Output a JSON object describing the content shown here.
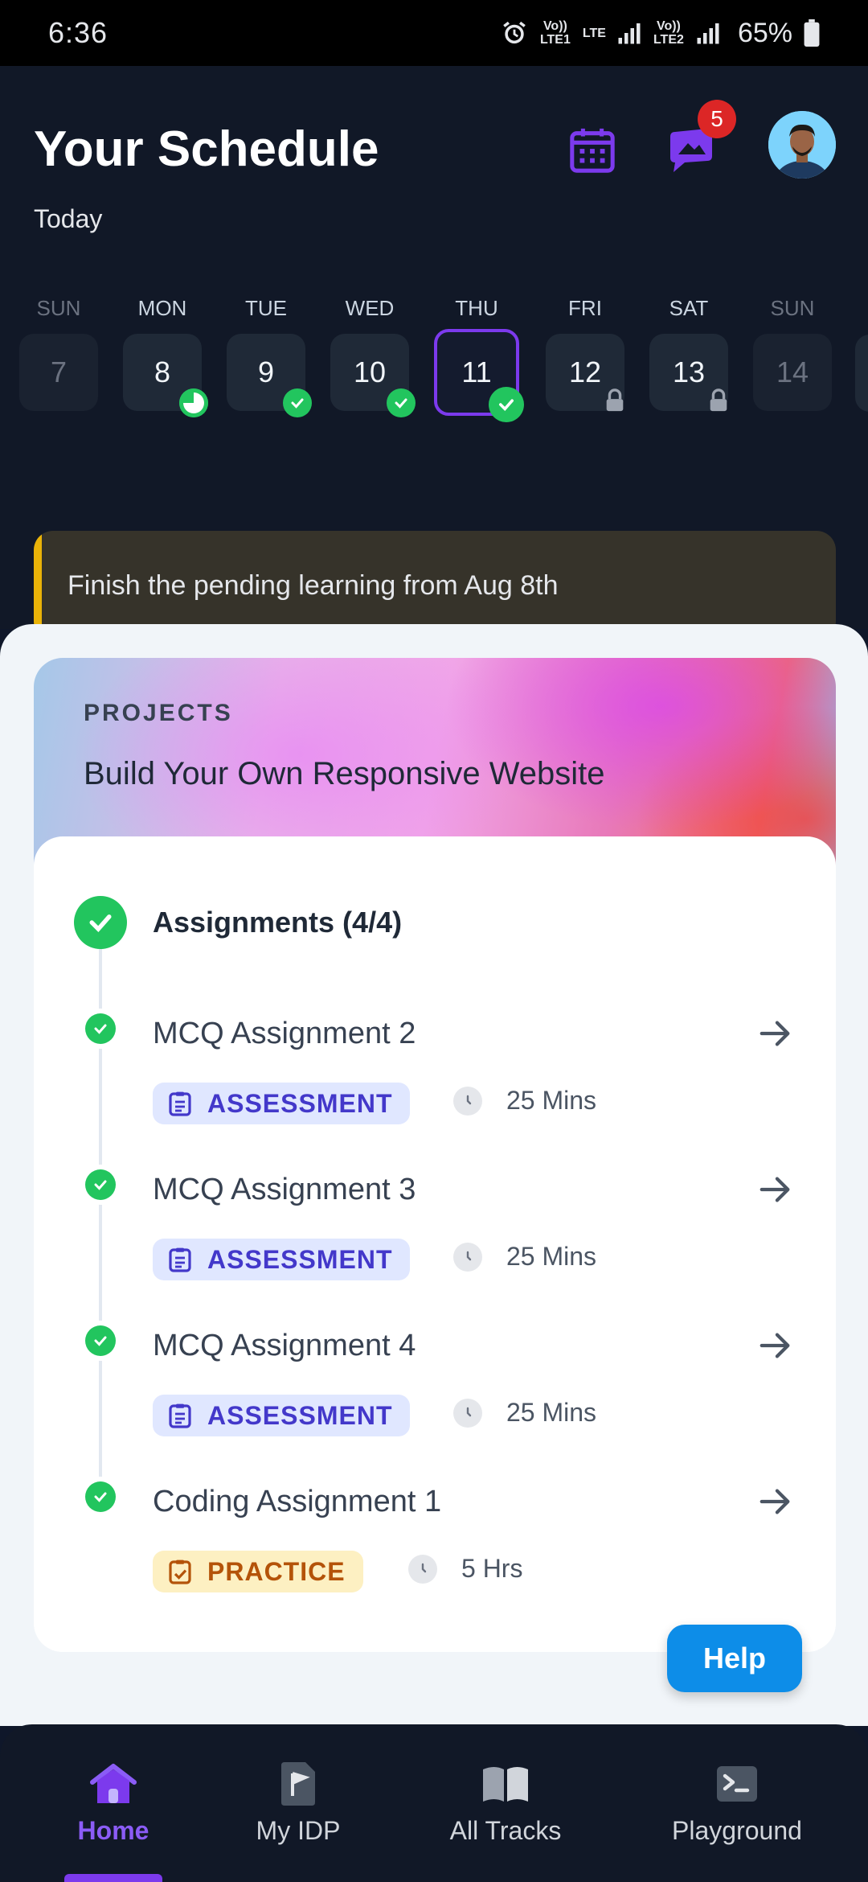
{
  "status_bar": {
    "time": "6:36",
    "carrier1": "Vo)) LTE1",
    "carrier2": "Vo)) LTE2",
    "net": "LTE",
    "battery": "65%"
  },
  "header": {
    "title": "Your Schedule",
    "subtitle": "Today",
    "notification_count": "5"
  },
  "week": [
    {
      "name": "SUN",
      "date": "7",
      "state": "muted"
    },
    {
      "name": "MON",
      "date": "8",
      "state": "partial"
    },
    {
      "name": "TUE",
      "date": "9",
      "state": "done"
    },
    {
      "name": "WED",
      "date": "10",
      "state": "done"
    },
    {
      "name": "THU",
      "date": "11",
      "state": "selected-done"
    },
    {
      "name": "FRI",
      "date": "12",
      "state": "locked"
    },
    {
      "name": "SAT",
      "date": "13",
      "state": "locked"
    },
    {
      "name": "SUN",
      "date": "14",
      "state": "muted"
    }
  ],
  "banner": {
    "text": "Finish the pending learning from Aug 8th"
  },
  "project": {
    "label": "PROJECTS",
    "title": "Build Your Own Responsive Website",
    "section_title": "Assignments (4/4)",
    "items": [
      {
        "name": "MCQ Assignment 2",
        "tag": "ASSESSMENT",
        "type": "assess",
        "duration": "25 Mins"
      },
      {
        "name": "MCQ Assignment 3",
        "tag": "ASSESSMENT",
        "type": "assess",
        "duration": "25 Mins"
      },
      {
        "name": "MCQ Assignment 4",
        "tag": "ASSESSMENT",
        "type": "assess",
        "duration": "25 Mins"
      },
      {
        "name": "Coding Assignment 1",
        "tag": "PRACTICE",
        "type": "practice",
        "duration": "5 Hrs"
      }
    ]
  },
  "help": {
    "label": "Help"
  },
  "nav": [
    {
      "label": "Home",
      "icon": "home-icon",
      "active": true
    },
    {
      "label": "My IDP",
      "icon": "flag-document-icon",
      "active": false
    },
    {
      "label": "All Tracks",
      "icon": "open-book-icon",
      "active": false
    },
    {
      "label": "Playground",
      "icon": "terminal-icon",
      "active": false
    }
  ],
  "colors": {
    "accent": "#7c3aed",
    "success": "#22c55e",
    "warning": "#eab308",
    "help": "#0d8de8",
    "badge": "#dc2626"
  }
}
